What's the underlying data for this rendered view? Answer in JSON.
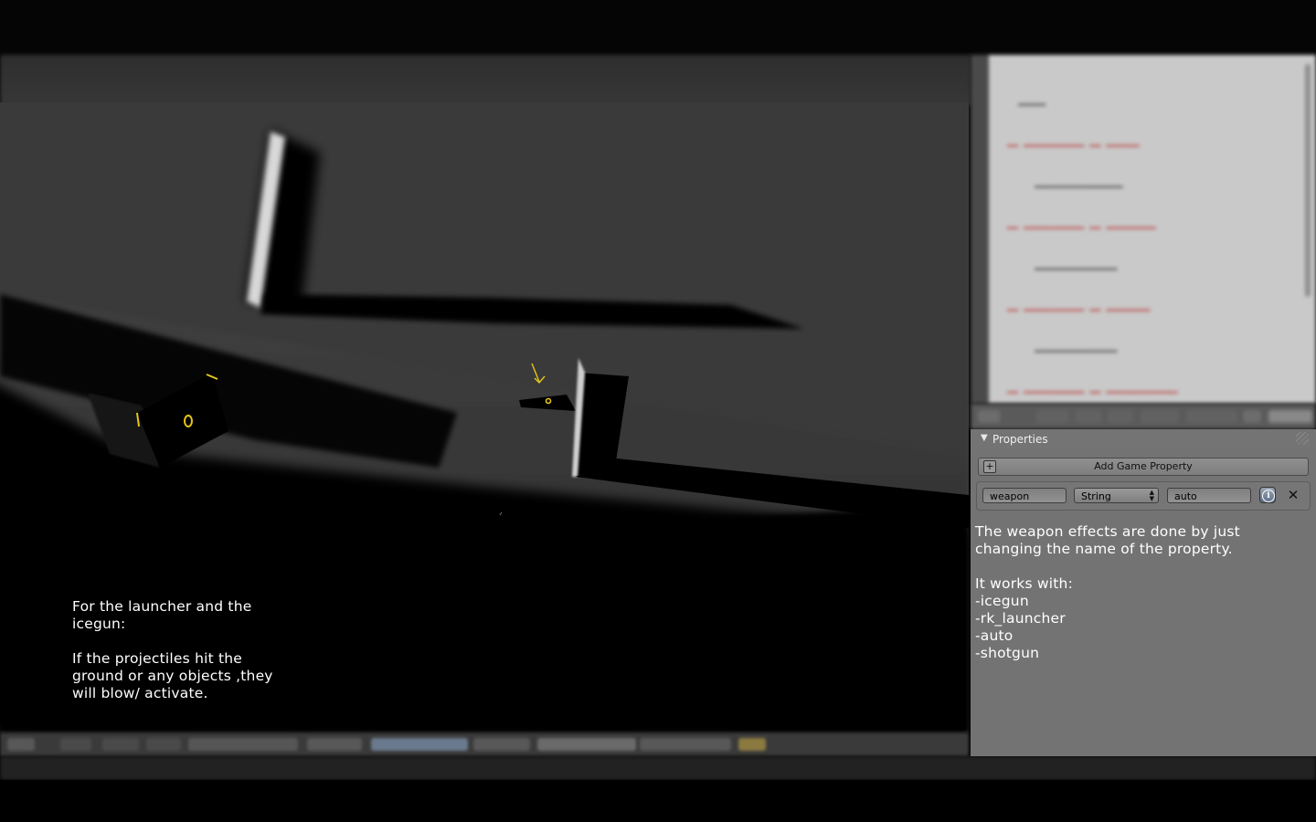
{
  "viewport": {
    "note_line_1": "For the launcher and the icegun:",
    "note_line_2": "If the projectiles hit the ground or any objects ,they will blow/ activate."
  },
  "properties_panel": {
    "title": "Properties",
    "add_button_label": "Add Game Property",
    "property": {
      "name": "weapon",
      "type": "String",
      "value": "auto"
    },
    "notes": {
      "intro": "The weapon effects are done by just changing the name of the property.",
      "works_with_heading": "It works with:",
      "items": [
        "-icegun",
        "-rk_launcher",
        "-auto",
        "-shotgun"
      ]
    }
  },
  "colors": {
    "object_outline": "#e5c61a",
    "panel_bg": "#737373",
    "viewport_bg": "#393939"
  }
}
